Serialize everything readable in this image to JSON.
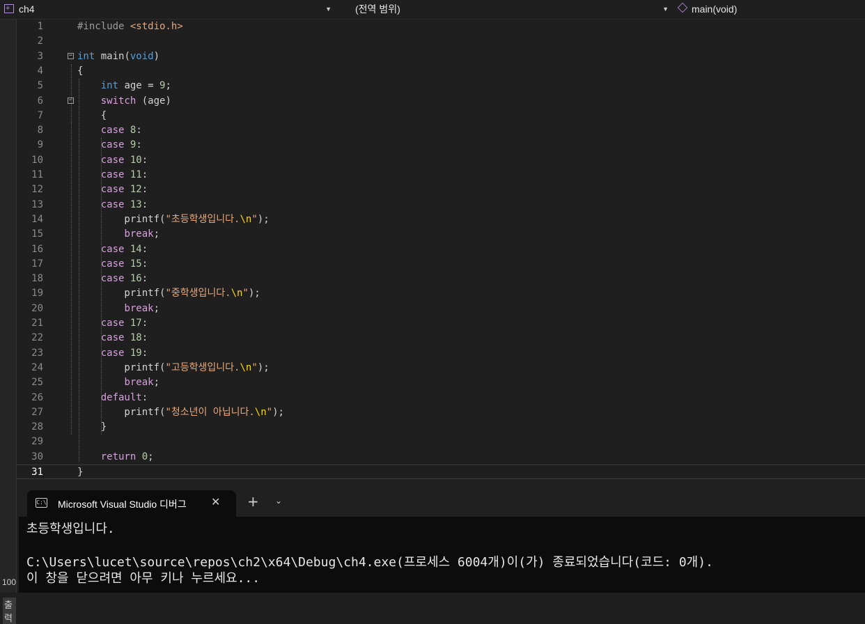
{
  "navbar": {
    "project": "ch4",
    "scope": "(전역 범위)",
    "member": "main(void)"
  },
  "left_strip": {
    "zoom": "100",
    "output_tab": "출력"
  },
  "editor": {
    "lines": [
      {
        "n": "1",
        "tokens": [
          {
            "t": "#include ",
            "c": "pp"
          },
          {
            "t": "<stdio.h>",
            "c": "inc"
          }
        ]
      },
      {
        "n": "2",
        "tokens": []
      },
      {
        "n": "3",
        "tokens": [
          {
            "t": "int",
            "c": "kw"
          },
          {
            "t": " main(",
            "c": ""
          },
          {
            "t": "void",
            "c": "kw"
          },
          {
            "t": ")",
            "c": ""
          }
        ]
      },
      {
        "n": "4",
        "tokens": [
          {
            "t": "{",
            "c": ""
          }
        ]
      },
      {
        "n": "5",
        "tokens": [
          {
            "t": "    ",
            "c": ""
          },
          {
            "t": "int",
            "c": "kw"
          },
          {
            "t": " age = ",
            "c": ""
          },
          {
            "t": "9",
            "c": "num"
          },
          {
            "t": ";",
            "c": ""
          }
        ]
      },
      {
        "n": "6",
        "tokens": [
          {
            "t": "    ",
            "c": ""
          },
          {
            "t": "switch",
            "c": "ctl"
          },
          {
            "t": " (age)",
            "c": ""
          }
        ]
      },
      {
        "n": "7",
        "tokens": [
          {
            "t": "    {",
            "c": ""
          }
        ]
      },
      {
        "n": "8",
        "tokens": [
          {
            "t": "    ",
            "c": ""
          },
          {
            "t": "case",
            "c": "ctl"
          },
          {
            "t": " ",
            "c": ""
          },
          {
            "t": "8",
            "c": "num"
          },
          {
            "t": ":",
            "c": ""
          }
        ]
      },
      {
        "n": "9",
        "tokens": [
          {
            "t": "    ",
            "c": ""
          },
          {
            "t": "case",
            "c": "ctl"
          },
          {
            "t": " ",
            "c": ""
          },
          {
            "t": "9",
            "c": "num"
          },
          {
            "t": ":",
            "c": ""
          }
        ]
      },
      {
        "n": "10",
        "tokens": [
          {
            "t": "    ",
            "c": ""
          },
          {
            "t": "case",
            "c": "ctl"
          },
          {
            "t": " ",
            "c": ""
          },
          {
            "t": "10",
            "c": "num"
          },
          {
            "t": ":",
            "c": ""
          }
        ]
      },
      {
        "n": "11",
        "tokens": [
          {
            "t": "    ",
            "c": ""
          },
          {
            "t": "case",
            "c": "ctl"
          },
          {
            "t": " ",
            "c": ""
          },
          {
            "t": "11",
            "c": "num"
          },
          {
            "t": ":",
            "c": ""
          }
        ]
      },
      {
        "n": "12",
        "tokens": [
          {
            "t": "    ",
            "c": ""
          },
          {
            "t": "case",
            "c": "ctl"
          },
          {
            "t": " ",
            "c": ""
          },
          {
            "t": "12",
            "c": "num"
          },
          {
            "t": ":",
            "c": ""
          }
        ]
      },
      {
        "n": "13",
        "tokens": [
          {
            "t": "    ",
            "c": ""
          },
          {
            "t": "case",
            "c": "ctl"
          },
          {
            "t": " ",
            "c": ""
          },
          {
            "t": "13",
            "c": "num"
          },
          {
            "t": ":",
            "c": ""
          }
        ]
      },
      {
        "n": "14",
        "tokens": [
          {
            "t": "        printf(",
            "c": ""
          },
          {
            "t": "\"초등학생입니다.",
            "c": "str"
          },
          {
            "t": "\\n",
            "c": "esc"
          },
          {
            "t": "\"",
            "c": "str"
          },
          {
            "t": ");",
            "c": ""
          }
        ]
      },
      {
        "n": "15",
        "tokens": [
          {
            "t": "        ",
            "c": ""
          },
          {
            "t": "break",
            "c": "ctl"
          },
          {
            "t": ";",
            "c": ""
          }
        ]
      },
      {
        "n": "16",
        "tokens": [
          {
            "t": "    ",
            "c": ""
          },
          {
            "t": "case",
            "c": "ctl"
          },
          {
            "t": " ",
            "c": ""
          },
          {
            "t": "14",
            "c": "num"
          },
          {
            "t": ":",
            "c": ""
          }
        ]
      },
      {
        "n": "17",
        "tokens": [
          {
            "t": "    ",
            "c": ""
          },
          {
            "t": "case",
            "c": "ctl"
          },
          {
            "t": " ",
            "c": ""
          },
          {
            "t": "15",
            "c": "num"
          },
          {
            "t": ":",
            "c": ""
          }
        ]
      },
      {
        "n": "18",
        "tokens": [
          {
            "t": "    ",
            "c": ""
          },
          {
            "t": "case",
            "c": "ctl"
          },
          {
            "t": " ",
            "c": ""
          },
          {
            "t": "16",
            "c": "num"
          },
          {
            "t": ":",
            "c": ""
          }
        ]
      },
      {
        "n": "19",
        "tokens": [
          {
            "t": "        printf(",
            "c": ""
          },
          {
            "t": "\"중학생입니다.",
            "c": "str"
          },
          {
            "t": "\\n",
            "c": "esc"
          },
          {
            "t": "\"",
            "c": "str"
          },
          {
            "t": ");",
            "c": ""
          }
        ]
      },
      {
        "n": "20",
        "tokens": [
          {
            "t": "        ",
            "c": ""
          },
          {
            "t": "break",
            "c": "ctl"
          },
          {
            "t": ";",
            "c": ""
          }
        ]
      },
      {
        "n": "21",
        "tokens": [
          {
            "t": "    ",
            "c": ""
          },
          {
            "t": "case",
            "c": "ctl"
          },
          {
            "t": " ",
            "c": ""
          },
          {
            "t": "17",
            "c": "num"
          },
          {
            "t": ":",
            "c": ""
          }
        ]
      },
      {
        "n": "22",
        "tokens": [
          {
            "t": "    ",
            "c": ""
          },
          {
            "t": "case",
            "c": "ctl"
          },
          {
            "t": " ",
            "c": ""
          },
          {
            "t": "18",
            "c": "num"
          },
          {
            "t": ":",
            "c": ""
          }
        ]
      },
      {
        "n": "23",
        "tokens": [
          {
            "t": "    ",
            "c": ""
          },
          {
            "t": "case",
            "c": "ctl"
          },
          {
            "t": " ",
            "c": ""
          },
          {
            "t": "19",
            "c": "num"
          },
          {
            "t": ":",
            "c": ""
          }
        ]
      },
      {
        "n": "24",
        "tokens": [
          {
            "t": "        printf(",
            "c": ""
          },
          {
            "t": "\"고등학생입니다.",
            "c": "str"
          },
          {
            "t": "\\n",
            "c": "esc"
          },
          {
            "t": "\"",
            "c": "str"
          },
          {
            "t": ");",
            "c": ""
          }
        ]
      },
      {
        "n": "25",
        "tokens": [
          {
            "t": "        ",
            "c": ""
          },
          {
            "t": "break",
            "c": "ctl"
          },
          {
            "t": ";",
            "c": ""
          }
        ]
      },
      {
        "n": "26",
        "tokens": [
          {
            "t": "    ",
            "c": ""
          },
          {
            "t": "default",
            "c": "ctl"
          },
          {
            "t": ":",
            "c": ""
          }
        ]
      },
      {
        "n": "27",
        "tokens": [
          {
            "t": "        printf(",
            "c": ""
          },
          {
            "t": "\"청소년이 아닙니다.",
            "c": "str"
          },
          {
            "t": "\\n",
            "c": "esc"
          },
          {
            "t": "\"",
            "c": "str"
          },
          {
            "t": ");",
            "c": ""
          }
        ]
      },
      {
        "n": "28",
        "tokens": [
          {
            "t": "    }",
            "c": ""
          }
        ]
      },
      {
        "n": "29",
        "tokens": []
      },
      {
        "n": "30",
        "tokens": [
          {
            "t": "    ",
            "c": ""
          },
          {
            "t": "return",
            "c": "ctl"
          },
          {
            "t": " ",
            "c": ""
          },
          {
            "t": "0",
            "c": "num"
          },
          {
            "t": ";",
            "c": ""
          }
        ]
      },
      {
        "n": "31",
        "tokens": [
          {
            "t": "}",
            "c": ""
          }
        ]
      }
    ],
    "current_line": "31"
  },
  "terminal": {
    "tab_title": "Microsoft Visual Studio 디버그",
    "icon_glyph": "C:\\",
    "close_glyph": "✕",
    "new_tab_glyph": "+",
    "dropdown_glyph": "⌄",
    "output_lines": [
      "초등학생입니다.",
      "",
      "C:\\Users\\lucet\\source\\repos\\ch2\\x64\\Debug\\ch4.exe(프로세스 6004개)이(가) 종료되었습니다(코드: 0개).",
      "이 창을 닫으려면 아무 키나 누르세요..."
    ]
  },
  "colors": {
    "editor_bg": "#1f1f1f",
    "keyword": "#569cd6",
    "control": "#d8a0df",
    "string": "#e8a87c",
    "number": "#b5cea8",
    "terminal_bg": "#0c0c0c"
  }
}
